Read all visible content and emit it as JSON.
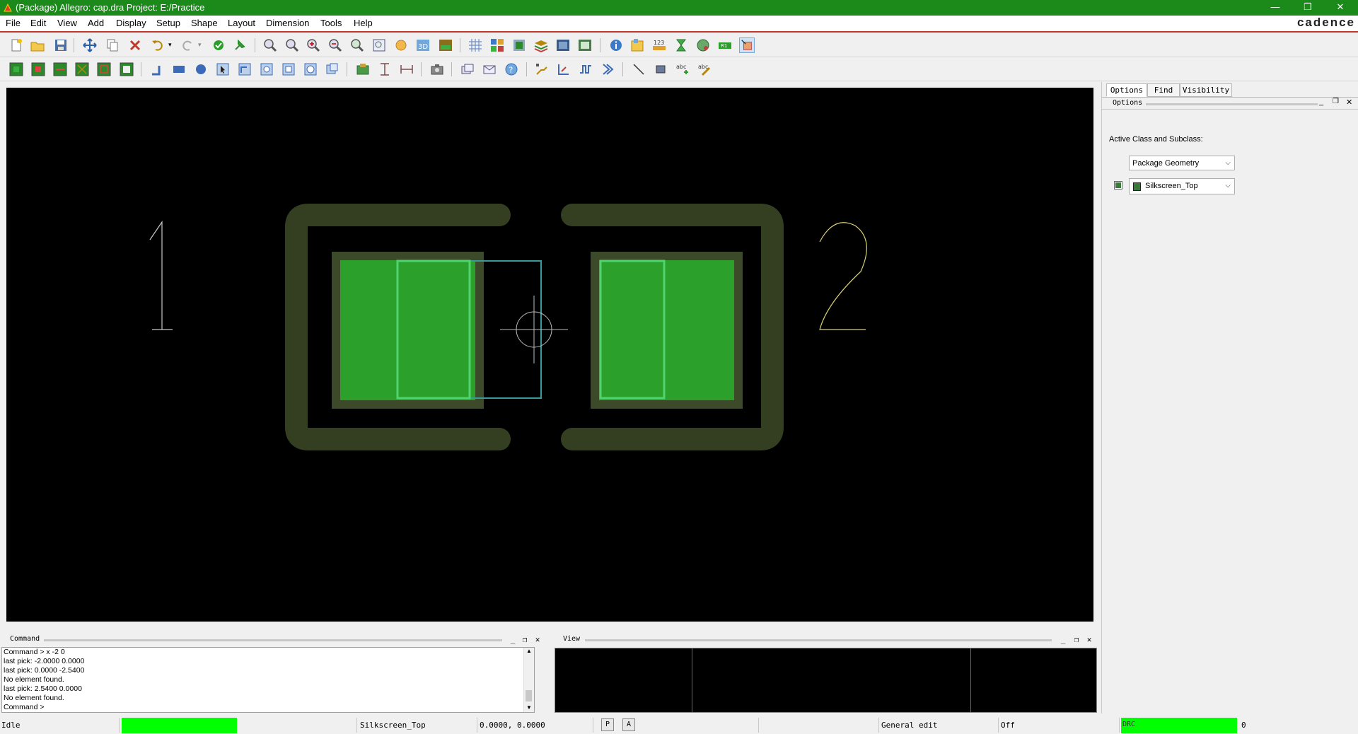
{
  "window": {
    "title": "(Package) Allegro: cap.dra  Project: E:/Practice",
    "brand": "cadence",
    "minimize": "—",
    "maximize": "❐",
    "close": "✕"
  },
  "menu": [
    "File",
    "Edit",
    "View",
    "Add",
    "Display",
    "Setup",
    "Shape",
    "Layout",
    "Dimension",
    "Tools",
    "Help"
  ],
  "canvas": {
    "pin_label_1": "1",
    "pin_label_2": "2",
    "colors": {
      "silkscreen": "#343f22",
      "pad": "#2ba12b",
      "pad_outline": "#3d4a2a",
      "assembly": "#4fd46f",
      "text": "#c8c8c8"
    }
  },
  "right_panel": {
    "tabs": [
      "Options",
      "Find",
      "Visibility"
    ],
    "header": "Options",
    "active_class_label": "Active Class and Subclass:",
    "class_value": "Package Geometry",
    "subclass_value": "Silkscreen_Top"
  },
  "command_panel": {
    "title": "Command",
    "lines": [
      "Command > x -2 0",
      "last pick:  -2.0000 0.0000",
      "last pick:  0.0000 -2.5400",
      "No element found.",
      "last pick:  2.5400 0.0000",
      "No element found.",
      "Command >"
    ]
  },
  "view_panel": {
    "title": "View"
  },
  "status_bar": {
    "state": "Idle",
    "subclass": "Silkscreen_Top",
    "coords": "0.0000,  0.0000",
    "p_button": "P",
    "a_button": "A",
    "mode": "General edit",
    "snap": "Off",
    "drc_label": "DRC",
    "drc_count": "0",
    "indicator_color": "#00ff00"
  }
}
